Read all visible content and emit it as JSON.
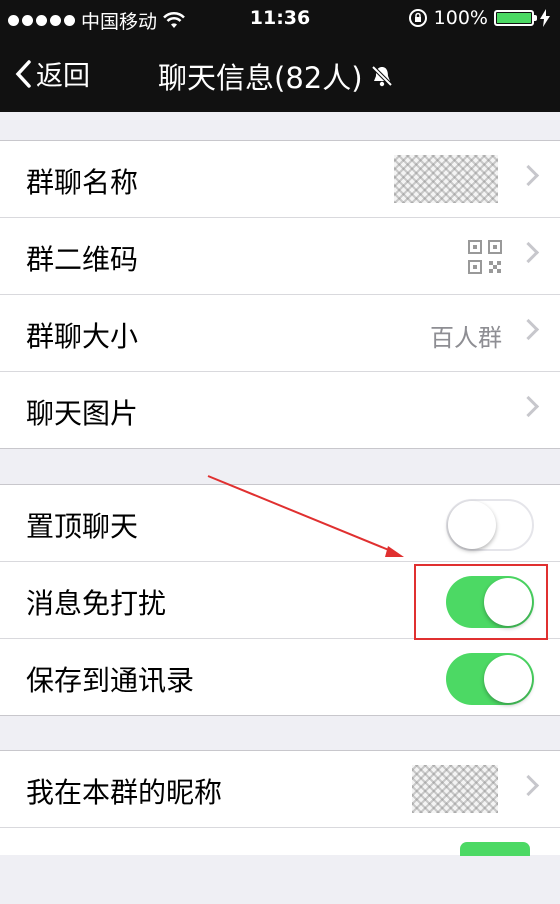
{
  "status_bar": {
    "carrier": "中国移动",
    "time": "11:36",
    "battery_percent": "100%",
    "battery_level": 1.0
  },
  "nav": {
    "back_label": "返回",
    "title": "聊天信息(82人)"
  },
  "group1": [
    {
      "label": "群聊名称",
      "value": ""
    },
    {
      "label": "群二维码",
      "value": ""
    },
    {
      "label": "群聊大小",
      "value": "百人群"
    },
    {
      "label": "聊天图片",
      "value": ""
    }
  ],
  "group2": [
    {
      "label": "置顶聊天",
      "toggle": "off"
    },
    {
      "label": "消息免打扰",
      "toggle": "on"
    },
    {
      "label": "保存到通讯录",
      "toggle": "on"
    }
  ],
  "group3": [
    {
      "label": "我在本群的昵称",
      "value": ""
    }
  ],
  "colors": {
    "toggle_on": "#4cd964",
    "highlight": "#e03030",
    "bar": "#111111"
  }
}
